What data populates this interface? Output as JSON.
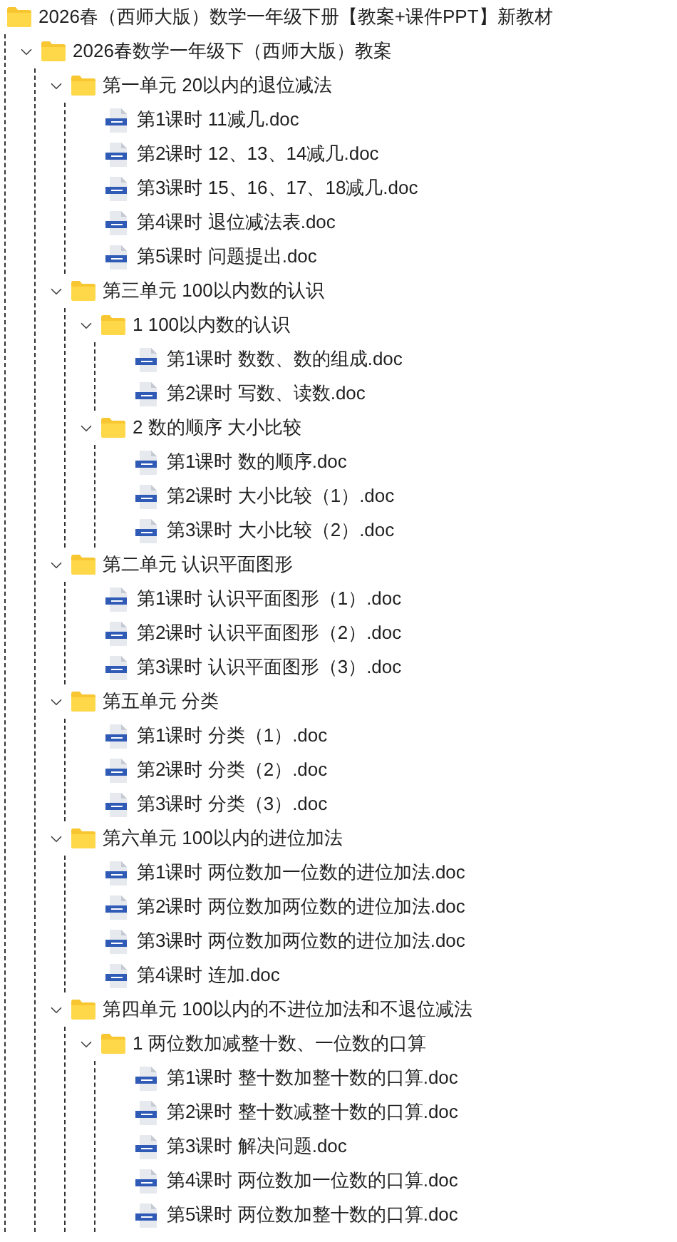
{
  "tree": {
    "name": "2026春（西师大版）数学一年级下册【教案+课件PPT】新教材",
    "kind": "folder",
    "children": [
      {
        "name": "2026春数学一年级下（西师大版）教案",
        "kind": "folder",
        "expanded": true,
        "children": [
          {
            "name": "第一单元 20以内的退位减法",
            "kind": "folder",
            "expanded": true,
            "children": [
              {
                "name": "第1课时 11减几.doc",
                "kind": "file"
              },
              {
                "name": "第2课时 12、13、14减几.doc",
                "kind": "file"
              },
              {
                "name": "第3课时 15、16、17、18减几.doc",
                "kind": "file"
              },
              {
                "name": "第4课时 退位减法表.doc",
                "kind": "file"
              },
              {
                "name": "第5课时 问题提出.doc",
                "kind": "file"
              }
            ]
          },
          {
            "name": "第三单元 100以内数的认识",
            "kind": "folder",
            "expanded": true,
            "children": [
              {
                "name": "1 100以内数的认识",
                "kind": "folder",
                "expanded": true,
                "children": [
                  {
                    "name": "第1课时 数数、数的组成.doc",
                    "kind": "file"
                  },
                  {
                    "name": "第2课时 写数、读数.doc",
                    "kind": "file"
                  }
                ]
              },
              {
                "name": "2 数的顺序 大小比较",
                "kind": "folder",
                "expanded": true,
                "children": [
                  {
                    "name": "第1课时 数的顺序.doc",
                    "kind": "file"
                  },
                  {
                    "name": "第2课时 大小比较（1）.doc",
                    "kind": "file"
                  },
                  {
                    "name": "第3课时 大小比较（2）.doc",
                    "kind": "file"
                  }
                ]
              }
            ]
          },
          {
            "name": "第二单元 认识平面图形",
            "kind": "folder",
            "expanded": true,
            "children": [
              {
                "name": "第1课时 认识平面图形（1）.doc",
                "kind": "file"
              },
              {
                "name": "第2课时 认识平面图形（2）.doc",
                "kind": "file"
              },
              {
                "name": "第3课时 认识平面图形（3）.doc",
                "kind": "file"
              }
            ]
          },
          {
            "name": "第五单元 分类",
            "kind": "folder",
            "expanded": true,
            "children": [
              {
                "name": "第1课时 分类（1）.doc",
                "kind": "file"
              },
              {
                "name": "第2课时 分类（2）.doc",
                "kind": "file"
              },
              {
                "name": "第3课时 分类（3）.doc",
                "kind": "file"
              }
            ]
          },
          {
            "name": "第六单元 100以内的进位加法",
            "kind": "folder",
            "expanded": true,
            "children": [
              {
                "name": "第1课时 两位数加一位数的进位加法.doc",
                "kind": "file"
              },
              {
                "name": "第2课时 两位数加两位数的进位加法.doc",
                "kind": "file"
              },
              {
                "name": "第3课时 两位数加两位数的进位加法.doc",
                "kind": "file"
              },
              {
                "name": "第4课时 连加.doc",
                "kind": "file"
              }
            ]
          },
          {
            "name": "第四单元 100以内的不进位加法和不退位减法",
            "kind": "folder",
            "expanded": true,
            "children": [
              {
                "name": "1 两位数加减整十数、一位数的口算",
                "kind": "folder",
                "expanded": true,
                "children": [
                  {
                    "name": "第1课时 整十数加整十数的口算.doc",
                    "kind": "file"
                  },
                  {
                    "name": "第2课时 整十数减整十数的口算.doc",
                    "kind": "file"
                  },
                  {
                    "name": "第3课时 解决问题.doc",
                    "kind": "file"
                  },
                  {
                    "name": "第4课时 两位数加一位数的口算.doc",
                    "kind": "file"
                  },
                  {
                    "name": "第5课时 两位数加整十数的口算.doc",
                    "kind": "file"
                  }
                ]
              }
            ]
          }
        ]
      }
    ]
  }
}
